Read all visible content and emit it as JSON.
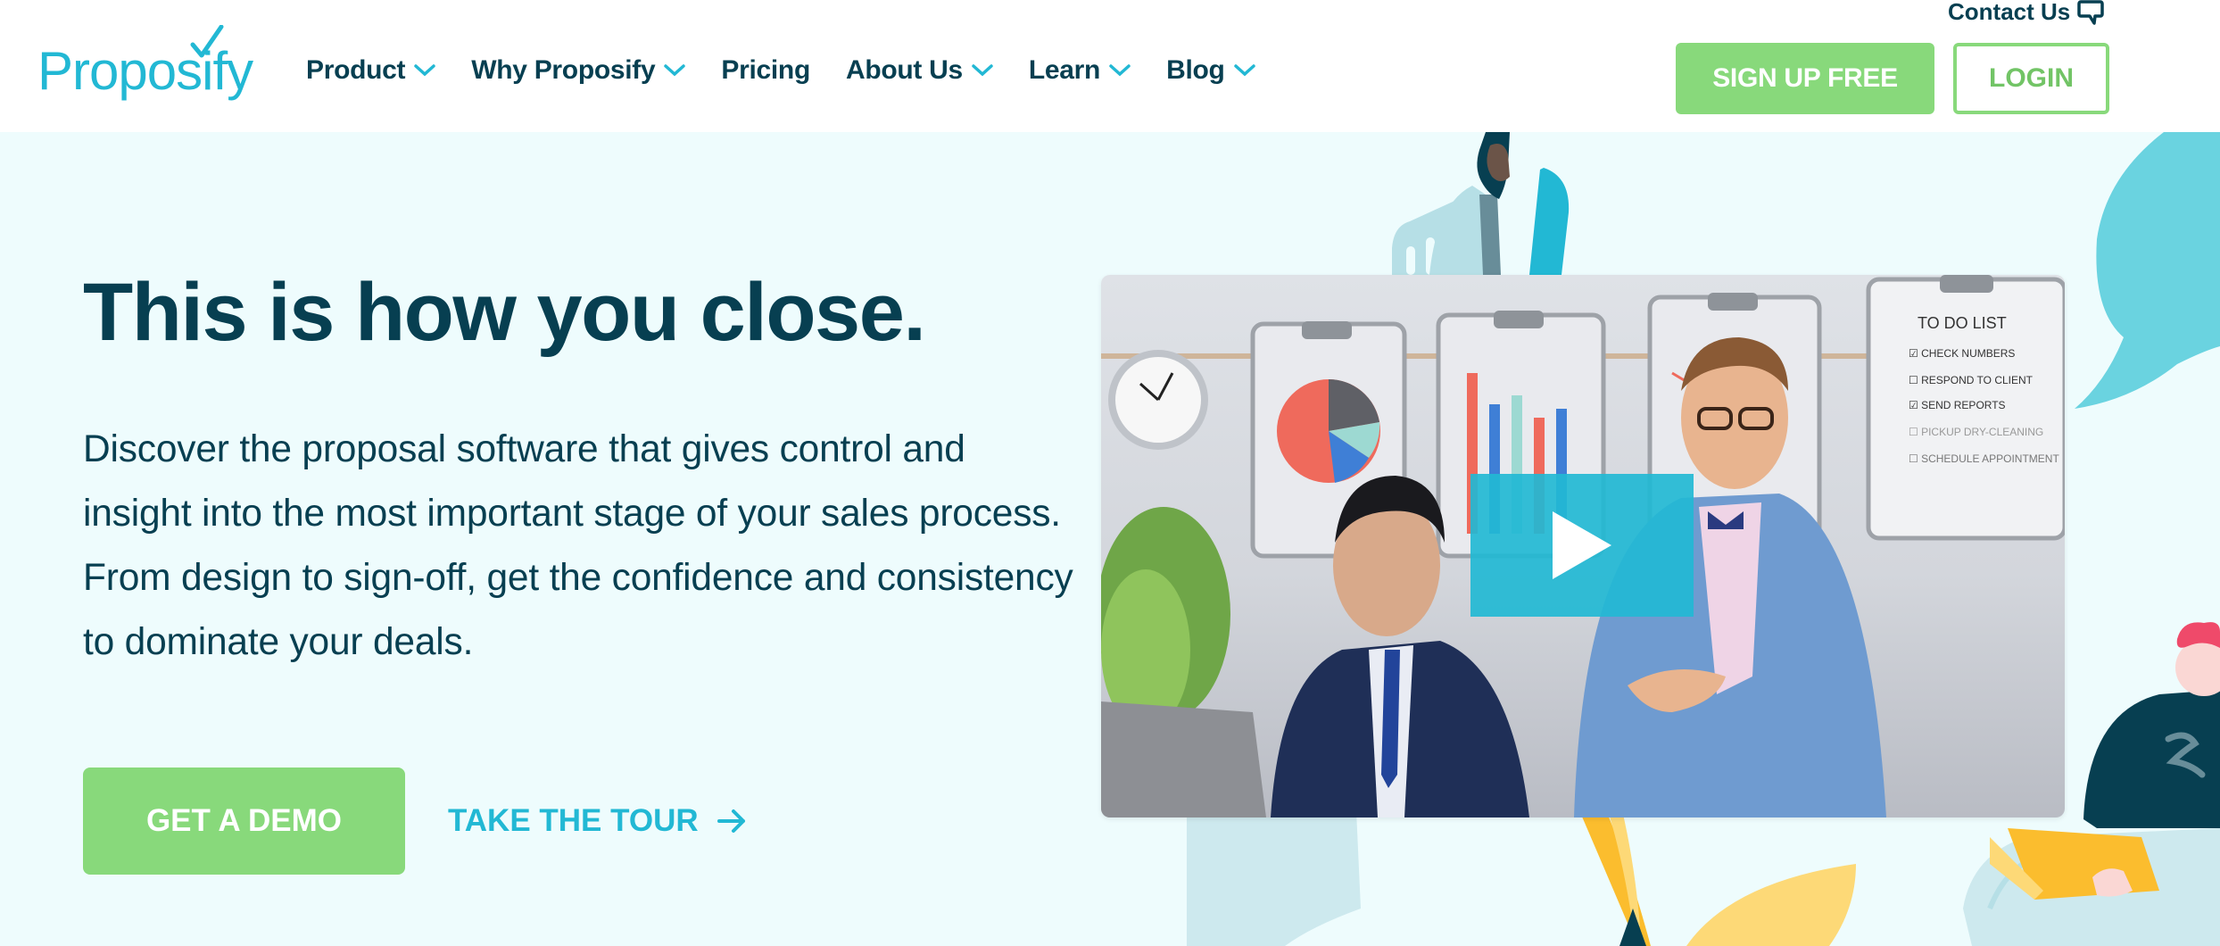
{
  "brand": {
    "name": "Proposify",
    "colors": {
      "primary_teal": "#22b8d4",
      "navy": "#073f51",
      "green": "#88d97b",
      "hero_bg": "#eefcfd"
    }
  },
  "header": {
    "logo_text": "Proposify",
    "nav": [
      {
        "label": "Product",
        "has_dropdown": true
      },
      {
        "label": "Why Proposify",
        "has_dropdown": true
      },
      {
        "label": "Pricing",
        "has_dropdown": false
      },
      {
        "label": "About Us",
        "has_dropdown": true
      },
      {
        "label": "Learn",
        "has_dropdown": true
      },
      {
        "label": "Blog",
        "has_dropdown": true
      }
    ],
    "contact_label": "Contact Us",
    "contact_icon": "speech-bubble-icon",
    "signup_label": "SIGN UP FREE",
    "login_label": "LOGIN"
  },
  "hero": {
    "headline": "This is how you close.",
    "subtext": "Discover the proposal software that gives control and insight into the most important stage of your sales process. From design to sign-off, get the confidence and consistency to dominate your deals.",
    "primary_cta": "GET A DEMO",
    "secondary_cta": "TAKE THE TOUR",
    "secondary_cta_icon": "arrow-right-icon",
    "video": {
      "play_icon": "play-icon",
      "whiteboard_todo": {
        "title": "TO DO LIST",
        "items": [
          {
            "text": "CHECK NUMBERS",
            "checked": true
          },
          {
            "text": "RESPOND TO CLIENT",
            "checked": false
          },
          {
            "text": "SEND REPORTS",
            "checked": true
          },
          {
            "text": "PICKUP DRY-CLEANING",
            "checked": false
          },
          {
            "text": "SCHEDULE APPOINTMENT",
            "checked": false
          }
        ]
      }
    }
  }
}
